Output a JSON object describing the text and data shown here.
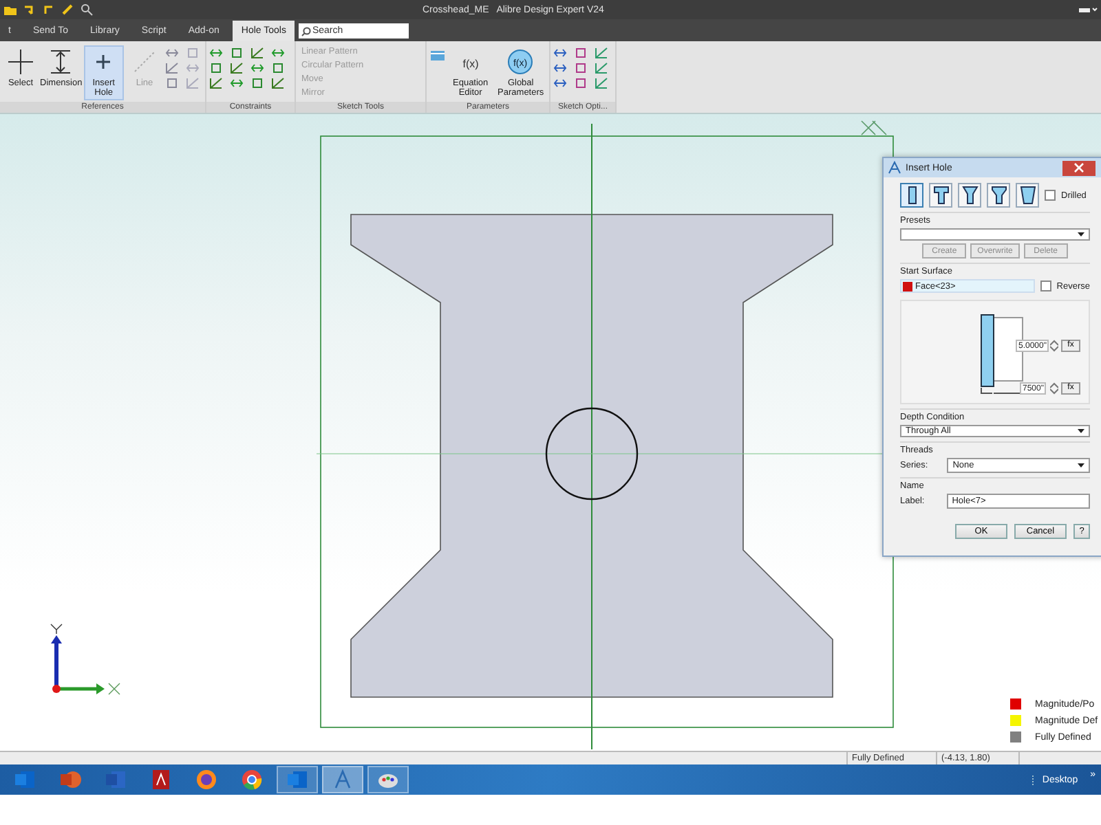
{
  "window": {
    "title": "Crosshead_ME   Alibre Design Expert V24"
  },
  "ribbon_tabs": [
    {
      "label": "t",
      "selected": false
    },
    {
      "label": "Send To",
      "selected": false
    },
    {
      "label": "Library",
      "selected": false
    },
    {
      "label": "Script",
      "selected": false
    },
    {
      "label": "Add-on",
      "selected": false
    },
    {
      "label": "Hole Tools",
      "selected": true
    }
  ],
  "search": {
    "placeholder": "Search"
  },
  "ribbon_groups": [
    {
      "kind": "tools",
      "label": "References",
      "tools": [
        {
          "kind": "select",
          "label": "Select",
          "selected": false,
          "disabled": false
        },
        {
          "kind": "dimension",
          "label": "Dimension",
          "selected": false,
          "disabled": false
        },
        {
          "kind": "hole",
          "label": "Insert Hole",
          "selected": true,
          "disabled": false
        },
        {
          "kind": "line",
          "label": "Line",
          "selected": false,
          "disabled": true
        }
      ]
    },
    {
      "kind": "constraints",
      "label": "Constraints"
    },
    {
      "kind": "patterns",
      "label": "Sketch Tools",
      "items": [
        {
          "label": "Linear Pattern",
          "disabled": true
        },
        {
          "label": "Circular Pattern",
          "disabled": true
        },
        {
          "label": "Move",
          "disabled": true
        },
        {
          "label": "Mirror",
          "disabled": true
        }
      ]
    },
    {
      "kind": "parameters",
      "label": "Parameters",
      "tools": [
        {
          "kind": "fx",
          "label": "Equation Editor",
          "icon_text": "f(x)",
          "selected": false,
          "disabled": false
        },
        {
          "kind": "fx_round",
          "label": "Global Parameters",
          "icon_text": "f(x)",
          "selected": false,
          "disabled": false
        }
      ]
    },
    {
      "kind": "options",
      "label": "Sketch Opti..."
    }
  ],
  "dialog": {
    "title": "Insert Hole",
    "hole_types": [
      {
        "kind": "simple",
        "selected": true
      },
      {
        "kind": "counterbore",
        "selected": false
      },
      {
        "kind": "countersink",
        "selected": false
      },
      {
        "kind": "taper",
        "selected": false
      },
      {
        "kind": "trapezoid",
        "selected": false
      }
    ],
    "drilled": {
      "label": "Drilled",
      "checked": false
    },
    "presets": {
      "label": "Presets",
      "buttons": [
        "Create",
        "Overwrite",
        "Delete"
      ]
    },
    "start_surface": {
      "label": "Start Surface",
      "value": "Face<23>",
      "reverse": {
        "label": "Reverse",
        "checked": false
      }
    },
    "diameter": {
      "value": "5.0000\"",
      "fx": "fx"
    },
    "depth": {
      "value": "7500\"",
      "fx": "fx"
    },
    "depth_condition": {
      "label": "Depth Condition",
      "value": "Through All"
    },
    "threads": {
      "label": "Threads",
      "series_label": "Series:",
      "series": "None"
    },
    "name": {
      "label": "Name",
      "field_label": "Label:",
      "value": "Hole<7>"
    },
    "buttons": [
      "OK",
      "Cancel",
      "?"
    ]
  },
  "legend": [
    {
      "label": "Magnitude/Po",
      "color": "#e00000"
    },
    {
      "label": "Magnitude Def",
      "color": "#f5f500"
    },
    {
      "label": "Fully Defined",
      "color": "#808080"
    }
  ],
  "status_bar": {
    "state": "Fully Defined",
    "coordinates": "(-4.13, 1.80)"
  },
  "taskbar": {
    "apps": [
      {
        "kind": "outlook",
        "selected": false
      },
      {
        "kind": "powerpoint",
        "selected": false
      },
      {
        "kind": "word",
        "selected": false
      },
      {
        "kind": "acrobat",
        "selected": false
      },
      {
        "kind": "firefox",
        "selected": false
      },
      {
        "kind": "chrome",
        "selected": false
      },
      {
        "kind": "outlook_running",
        "selected": false
      },
      {
        "kind": "cad",
        "selected": true
      },
      {
        "kind": "paint",
        "selected": false
      }
    ],
    "desktop": "Desktop",
    "chevron": "»"
  }
}
